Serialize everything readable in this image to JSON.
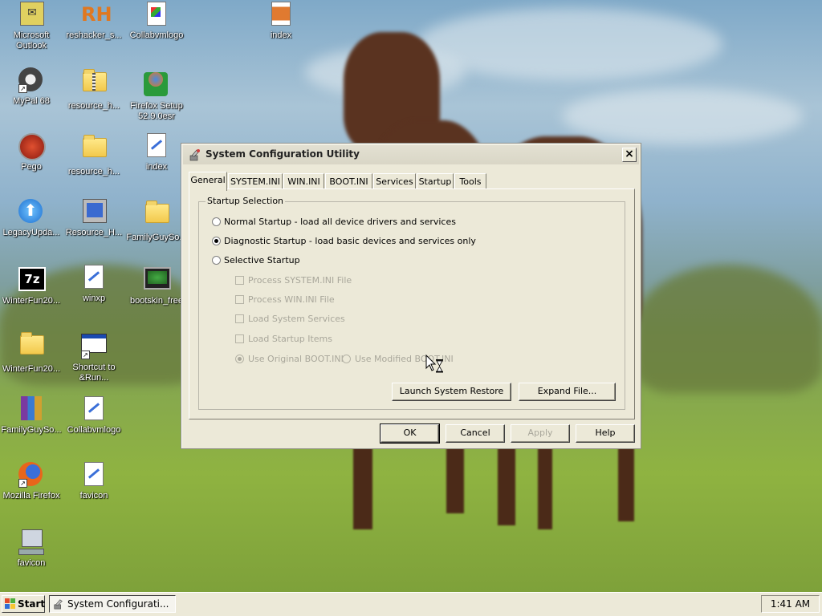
{
  "desktop": {
    "icons": [
      {
        "label": "Microsoft\nOutlook",
        "icon": "outlook-icon"
      },
      {
        "label": "reshacker_s...",
        "icon": "reshacker-icon"
      },
      {
        "label": "Collabvmlogo",
        "icon": "image-file-icon"
      },
      {
        "label": "index",
        "icon": "archive-icon"
      },
      {
        "label": "MyPal 68",
        "icon": "mypal-icon"
      },
      {
        "label": "resource_h...",
        "icon": "zip-folder-icon"
      },
      {
        "label": "Firefox Setup\n52.9.0esr",
        "icon": "firefox-setup-icon"
      },
      {
        "label": "Pego",
        "icon": "pego-icon"
      },
      {
        "label": "resource_h...",
        "icon": "folder-icon"
      },
      {
        "label": "index",
        "icon": "paint-file-icon"
      },
      {
        "label": "LegacyUpda...",
        "icon": "legacy-update-icon"
      },
      {
        "label": "Resource_H...",
        "icon": "resource-hacker-icon"
      },
      {
        "label": "FamilyGuySo...",
        "icon": "folder-icon"
      },
      {
        "label": "WinterFun20...",
        "icon": "7zip-icon"
      },
      {
        "label": "winxp",
        "icon": "paint-file-icon"
      },
      {
        "label": "bootskin_free",
        "icon": "bootskin-icon"
      },
      {
        "label": "WinterFun20...",
        "icon": "folder-icon"
      },
      {
        "label": "Shortcut to\n&Run...",
        "icon": "run-shortcut-icon"
      },
      {
        "label": "FamilyGuySo...",
        "icon": "winrar-icon"
      },
      {
        "label": "Collabvmlogo",
        "icon": "paint-file-icon"
      },
      {
        "label": "Mozilla Firefox",
        "icon": "firefox-icon"
      },
      {
        "label": "favicon",
        "icon": "paint-file-icon"
      },
      {
        "label": "favicon",
        "icon": "computer-icon"
      }
    ]
  },
  "dialog": {
    "title": "System Configuration Utility",
    "close_label": "×",
    "tabs": [
      "General",
      "SYSTEM.INI",
      "WIN.INI",
      "BOOT.INI",
      "Services",
      "Startup",
      "Tools"
    ],
    "active_tab": "General",
    "group_label": "Startup Selection",
    "options": [
      {
        "label": "Normal Startup - load all device drivers and services",
        "checked": false
      },
      {
        "label": "Diagnostic Startup - load basic devices and services only",
        "checked": true
      },
      {
        "label": "Selective Startup",
        "checked": false
      }
    ],
    "selective_items": [
      {
        "label": "Process SYSTEM.INI File",
        "checked": false,
        "enabled": false
      },
      {
        "label": "Process WIN.INI File",
        "checked": false,
        "enabled": false
      },
      {
        "label": "Load System Services",
        "checked": false,
        "enabled": false
      },
      {
        "label": "Load Startup Items",
        "checked": false,
        "enabled": false
      }
    ],
    "boot_options": [
      {
        "label": "Use Original BOOT.INI",
        "checked": true,
        "enabled": false
      },
      {
        "label": "Use Modified BOOT.INI",
        "checked": false,
        "enabled": false
      }
    ],
    "launch_restore_label": "Launch System Restore",
    "expand_file_label": "Expand File...",
    "ok_label": "OK",
    "cancel_label": "Cancel",
    "apply_label": "Apply",
    "help_label": "Help"
  },
  "taskbar": {
    "start_label": "Start",
    "task_label": "System Configurati...",
    "clock": "1:41 AM"
  }
}
